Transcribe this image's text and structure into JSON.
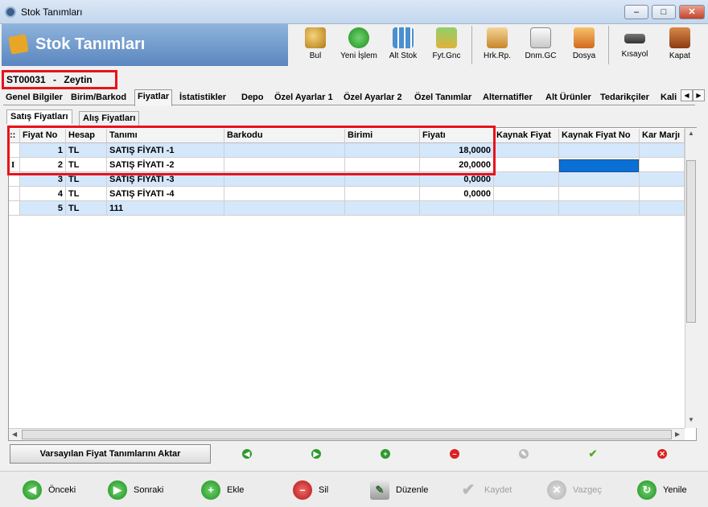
{
  "window": {
    "title": "Stok Tanımları"
  },
  "header": {
    "title": "Stok Tanımları"
  },
  "toolbar": [
    {
      "label": "Bul",
      "icon": "search-icon"
    },
    {
      "label": "Yeni İşlem",
      "icon": "add-icon"
    },
    {
      "label": "Alt Stok",
      "icon": "grid-icon"
    },
    {
      "label": "Fyt.Gnc",
      "icon": "price-icon"
    },
    {
      "label": "Hrk.Rp.",
      "icon": "report-icon"
    },
    {
      "label": "Dnm.GC",
      "icon": "document-icon"
    },
    {
      "label": "Dosya",
      "icon": "folder-icon"
    },
    {
      "label": "Kısayol",
      "icon": "keyboard-icon"
    },
    {
      "label": "Kapat",
      "icon": "exit-icon"
    }
  ],
  "stock": {
    "code": "ST00031",
    "dash": "-",
    "name": "Zeytin"
  },
  "tabs": [
    "Genel Bilgiler",
    "Birim/Barkod",
    "Fiyatlar",
    "İstatistikler",
    "Depo",
    "Özel Ayarlar 1",
    "Özel Ayarlar 2",
    "Özel Tanımlar",
    "Alternatifler",
    "Alt Ürünler",
    "Tedarikçiler",
    "Kali"
  ],
  "subtabs": [
    "Satış Fiyatları",
    "Alış Fiyatları"
  ],
  "grid": {
    "columns": [
      ":: ",
      "Fiyat No",
      "Hesap",
      "Tanımı",
      "Barkodu",
      "Birimi",
      "Fiyatı",
      "Kaynak Fiyat",
      "Kaynak Fiyat No",
      "Kar Marjı"
    ],
    "rows": [
      {
        "indicator": "",
        "no": "1",
        "hesap": "TL",
        "tanim": "SATIŞ FİYATI -1",
        "barkod": "",
        "birim": "",
        "fiyat": "18,0000"
      },
      {
        "indicator": "I",
        "no": "2",
        "hesap": "TL",
        "tanim": "SATIŞ FİYATI -2",
        "barkod": "",
        "birim": "",
        "fiyat": "20,0000"
      },
      {
        "indicator": "",
        "no": "3",
        "hesap": "TL",
        "tanim": "SATIŞ FİYATI -3",
        "barkod": "",
        "birim": "",
        "fiyat": "0,0000"
      },
      {
        "indicator": "",
        "no": "4",
        "hesap": "TL",
        "tanim": "SATIŞ FİYATI -4",
        "barkod": "",
        "birim": "",
        "fiyat": "0,0000"
      },
      {
        "indicator": "",
        "no": "5",
        "hesap": "TL",
        "tanim": "111",
        "barkod": "",
        "birim": "",
        "fiyat": ""
      }
    ]
  },
  "actions": {
    "aktar_label": "Varsayılan Fiyat Tanımlarını Aktar"
  },
  "nav": [
    {
      "label": "Önceki",
      "enabled": true
    },
    {
      "label": "Sonraki",
      "enabled": true
    },
    {
      "label": "Ekle",
      "enabled": true
    },
    {
      "label": "Sil",
      "enabled": true
    },
    {
      "label": "Düzenle",
      "enabled": true
    },
    {
      "label": "Kaydet",
      "enabled": false
    },
    {
      "label": "Vazgeç",
      "enabled": false
    },
    {
      "label": "Yenile",
      "enabled": true
    }
  ],
  "colors": {
    "accent": "#e8131b",
    "row_alt": "#d5e7fb",
    "selected_cell": "#0a6fd6",
    "banner": "#5b86bf"
  }
}
